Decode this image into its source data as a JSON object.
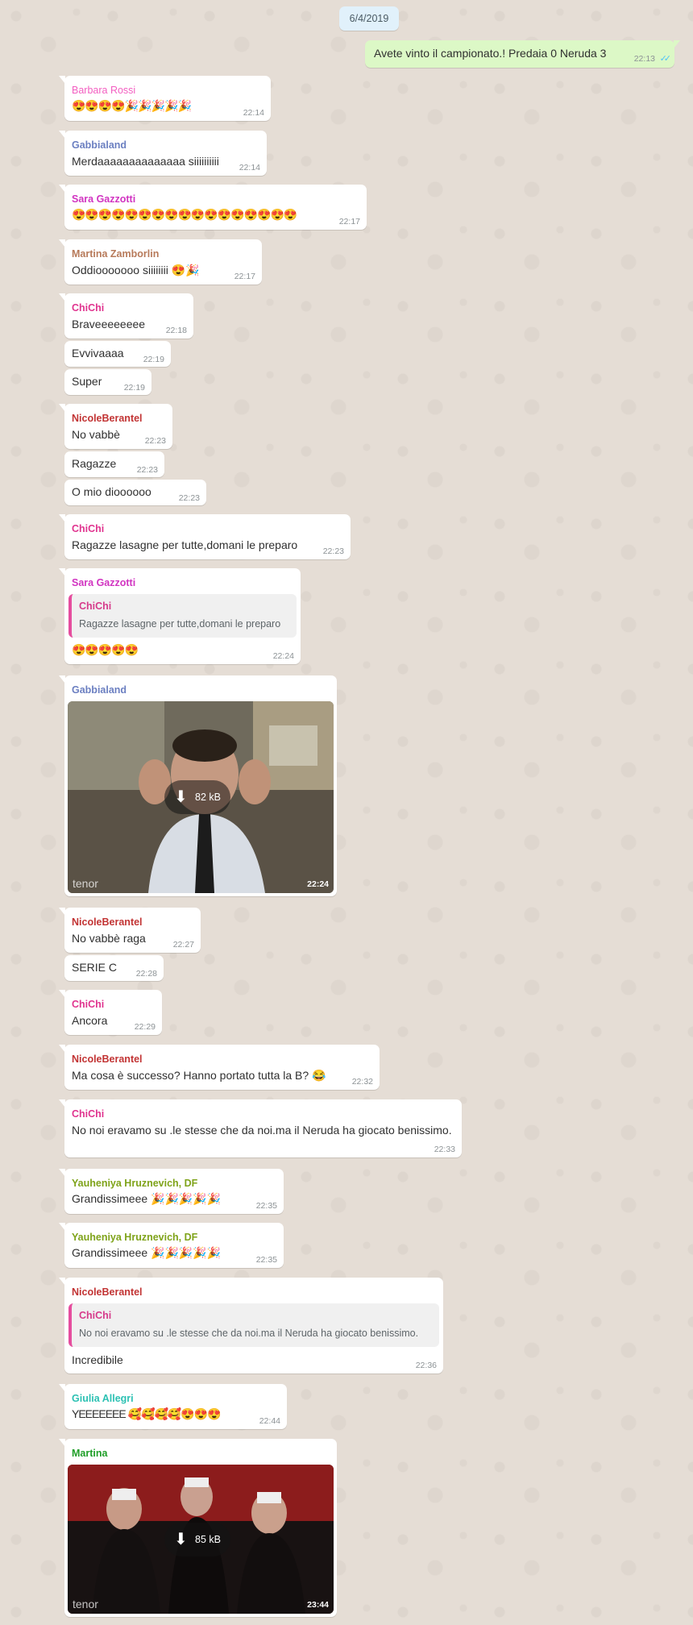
{
  "date_chip": "6/4/2019",
  "colors": {
    "barbara": "#f35ec1",
    "gabbialand": "#6b7fc1",
    "sara": "#d134c1",
    "martina_z": "#b77a5a",
    "chichi": "#e0348f",
    "nicole": "#c23434",
    "yauheniya": "#7fa31a",
    "giulia": "#2cc1b3",
    "martina": "#1f9e27"
  },
  "messages": {
    "m1": {
      "text": "Avete vinto il campionato.! Predaia 0 Neruda 3",
      "time": "22:13"
    },
    "m2": {
      "sender": "Barbara Rossi",
      "text": "😍😍😍😍🎉🎉🎉🎉🎉",
      "time": "22:14"
    },
    "m3": {
      "sender": "Gabbialand",
      "text": "Merdaaaaaaaaaaaaaa siiiiiiiiii",
      "time": "22:14"
    },
    "m4": {
      "sender": "Sara Gazzotti",
      "text": "😍😍😍😍😍😍😍😍😍😍😍😍😍😍😍😍😍",
      "time": "22:17"
    },
    "m5": {
      "sender": "Martina Zamborlin",
      "text": "Oddiooooooo siiiiiiii 😍🎉",
      "time": "22:17"
    },
    "m6": {
      "sender": "ChiChi",
      "text": "Braveeeeeeee",
      "time": "22:18"
    },
    "m7": {
      "text": "Evvivaaaa",
      "time": "22:19"
    },
    "m8": {
      "text": "Super",
      "time": "22:19"
    },
    "m9": {
      "sender": "NicoleBerantel",
      "text": "No vabbè",
      "time": "22:23"
    },
    "m10": {
      "text": "Ragazze",
      "time": "22:23"
    },
    "m11": {
      "text": "O mio dioooooo",
      "time": "22:23"
    },
    "m12": {
      "sender": "ChiChi",
      "text": "Ragazze lasagne per tutte,domani le preparo",
      "time": "22:23"
    },
    "m13": {
      "sender": "Sara Gazzotti",
      "quote_name": "ChiChi",
      "quote_text": "Ragazze lasagne per tutte,domani le preparo",
      "text": "😍😍😍😍😍",
      "time": "22:24"
    },
    "m14": {
      "sender": "Gabbialand",
      "size": "82 kB",
      "brand": "tenor",
      "time": "22:24"
    },
    "m15": {
      "sender": "NicoleBerantel",
      "text": "No vabbè raga",
      "time": "22:27"
    },
    "m16": {
      "text": "SERIE C",
      "time": "22:28"
    },
    "m17": {
      "sender": "ChiChi",
      "text": "Ancora",
      "time": "22:29"
    },
    "m18": {
      "sender": "NicoleBerantel",
      "text": "Ma cosa è successo? Hanno portato tutta la B? 😂",
      "time": "22:32"
    },
    "m19": {
      "sender": "ChiChi",
      "text": "No noi eravamo su .le stesse che da noi.ma il Neruda ha giocato benissimo.",
      "time": "22:33"
    },
    "m20": {
      "sender": "Yauheniya Hruznevich, DF",
      "text": "Grandissimeee 🎉🎉🎉🎉🎉",
      "time": "22:35"
    },
    "m21": {
      "sender": "Yauheniya Hruznevich, DF",
      "text": "Grandissimeee 🎉🎉🎉🎉🎉",
      "time": "22:35"
    },
    "m22": {
      "sender": "NicoleBerantel",
      "quote_name": "ChiChi",
      "quote_text": "No noi eravamo su .le stesse che da noi.ma il Neruda ha giocato benissimo.",
      "text": "Incredibile",
      "time": "22:36"
    },
    "m23": {
      "sender": "Giulia Allegri",
      "text": "YEEEEEEE 🥰🥰🥰🥰😍😍😍",
      "time": "22:44"
    },
    "m24": {
      "sender": "Martina",
      "size": "85 kB",
      "brand": "tenor",
      "time": "23:44"
    }
  }
}
